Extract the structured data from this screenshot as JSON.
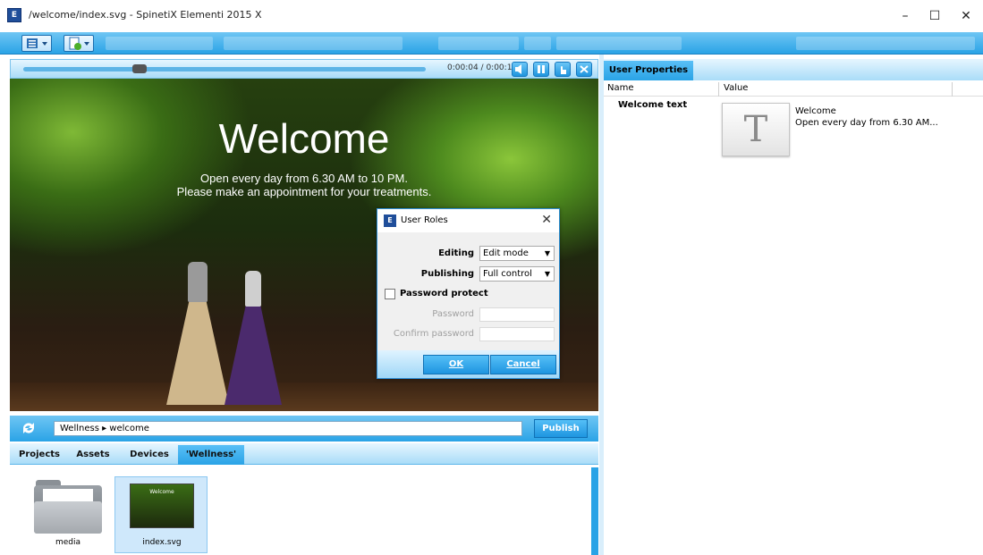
{
  "window": {
    "title": "/welcome/index.svg - SpinetiX Elementi 2015 X",
    "icon_text": "E",
    "controls": {
      "minimize": "–",
      "maximize": "☐",
      "close": "✕"
    }
  },
  "preview": {
    "time": "0:00:04 / 0:00:15",
    "progress": 0.27,
    "heading": "Welcome",
    "line1": "Open every day from 6.30 AM to 10 PM.",
    "line2": "Please make an appointment for your treatments."
  },
  "dialog": {
    "title": "User Roles",
    "close": "✕",
    "editing_label": "Editing",
    "editing_value": "Edit mode",
    "publishing_label": "Publishing",
    "publishing_value": "Full control",
    "password_protect_label": "Password protect",
    "password_label": "Password",
    "confirm_label": "Confirm password",
    "ok_label": "OK",
    "cancel_label": "Cancel"
  },
  "pathbar": {
    "path": "Wellness  ▸  welcome",
    "publish_label": "Publish"
  },
  "tabs": [
    {
      "label": "Projects"
    },
    {
      "label": "Assets"
    },
    {
      "label": "Devices"
    },
    {
      "label": "'Wellness'"
    }
  ],
  "files": [
    {
      "name": "media"
    },
    {
      "name": "index.svg",
      "thumb_title": "Welcome"
    }
  ],
  "properties": {
    "tab_label": "User Properties",
    "col_name": "Name",
    "col_value": "Value",
    "row_label": "Welcome text",
    "row_icon": "T",
    "row_value_1": "Welcome",
    "row_value_2": "Open every day from 6.30 AM..."
  }
}
